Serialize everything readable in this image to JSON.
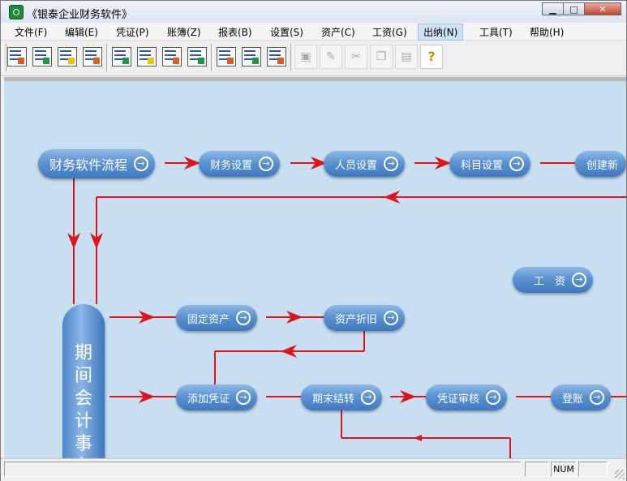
{
  "window": {
    "title": "《银泰企业财务软件》"
  },
  "menu": [
    {
      "label": "文件(F)"
    },
    {
      "label": "编辑(E)"
    },
    {
      "label": "凭证(P)"
    },
    {
      "label": "账簿(Z)"
    },
    {
      "label": "报表(B)"
    },
    {
      "label": "设置(S)"
    },
    {
      "label": "资产(C)"
    },
    {
      "label": "工资(G)"
    },
    {
      "label": "出纳(N)",
      "active": true
    },
    {
      "label": "工具(T)"
    },
    {
      "label": "帮助(H)"
    }
  ],
  "flow": {
    "start": "财务软件流程",
    "finance_setup": "财务设置",
    "staff_setup": "人员设置",
    "account_setup": "科目设置",
    "create_new": "创建新",
    "salary": "工　资",
    "fixed_assets": "固定资产",
    "depreciation": "资产折旧",
    "add_voucher": "添加凭证",
    "period_close": "期末结转",
    "voucher_audit": "凭证审核",
    "posting": "登账",
    "period_accounting": [
      "期",
      "间",
      "会",
      "计",
      "事",
      "务"
    ],
    "arrow_glyph": "→",
    "line_color": "#e0141a"
  },
  "status": {
    "num": "NUM"
  }
}
